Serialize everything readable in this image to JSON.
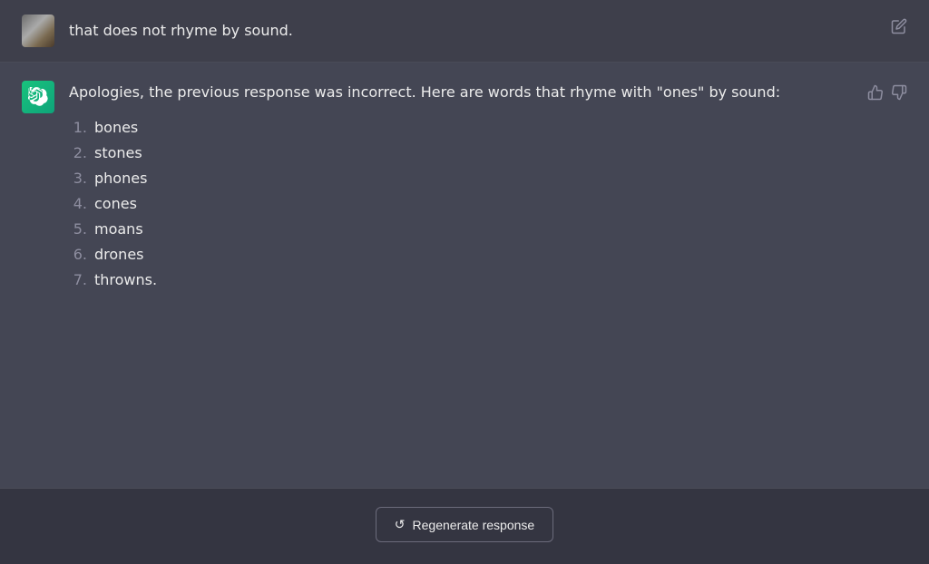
{
  "user_message": {
    "text": "that does not rhyme by sound.",
    "edit_icon": "✎"
  },
  "assistant_message": {
    "intro": "Apologies, the previous response was incorrect. Here are words that rhyme with \"ones\" by sound:",
    "rhyme_list": [
      {
        "number": "1.",
        "word": "bones"
      },
      {
        "number": "2.",
        "word": "stones"
      },
      {
        "number": "3.",
        "word": "phones"
      },
      {
        "number": "4.",
        "word": "cones"
      },
      {
        "number": "5.",
        "word": "moans"
      },
      {
        "number": "6.",
        "word": "drones"
      },
      {
        "number": "7.",
        "word": "throwns."
      }
    ]
  },
  "actions": {
    "thumbs_up": "👍",
    "thumbs_down": "👎",
    "regenerate_label": "Regenerate response",
    "regenerate_icon": "↺",
    "edit_label": "Edit message"
  }
}
